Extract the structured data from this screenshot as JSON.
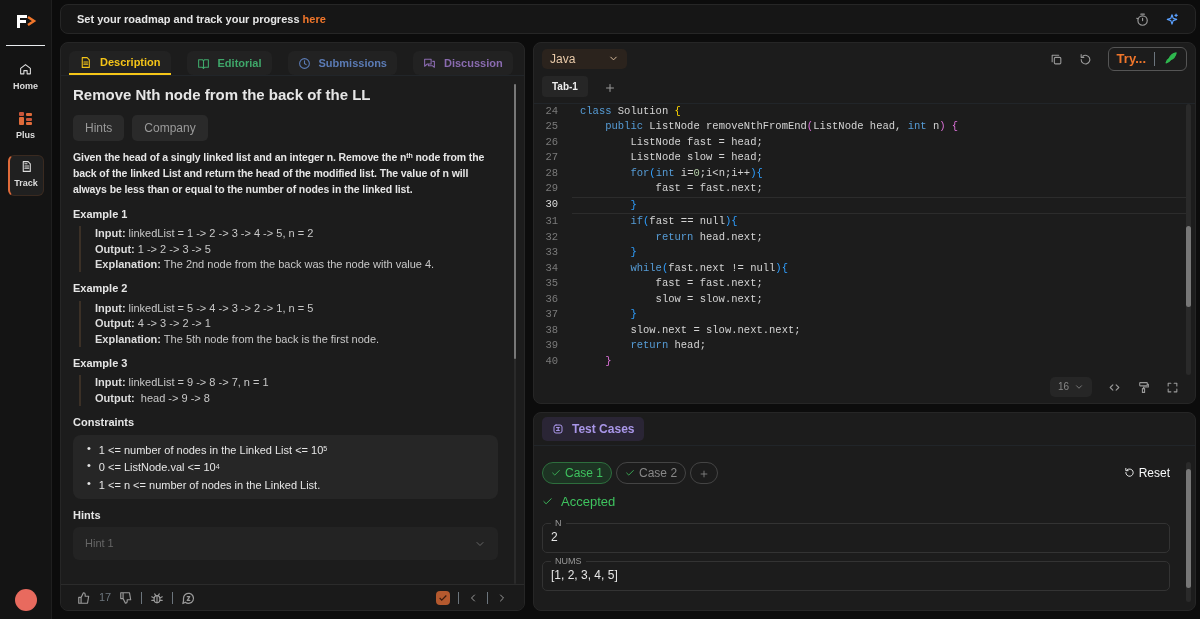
{
  "sidebar": {
    "items": [
      {
        "label": "Home",
        "kind": "home",
        "selected": false
      },
      {
        "label": "Plus",
        "kind": "plus",
        "selected": false
      },
      {
        "label": "Track",
        "kind": "track",
        "selected": true
      }
    ]
  },
  "banner": {
    "text": "Set your roadmap and track your progress",
    "link": "here"
  },
  "description": {
    "tabs": [
      {
        "label": "Description",
        "kind": "description",
        "selected": true,
        "color": "#f5c518"
      },
      {
        "label": "Editorial",
        "kind": "editorial",
        "selected": false,
        "color": "#3fa76a"
      },
      {
        "label": "Submissions",
        "kind": "submissions",
        "selected": false,
        "color": "#5b7bb5"
      },
      {
        "label": "Discussion",
        "kind": "discussion",
        "selected": false,
        "color": "#8a6bb0"
      }
    ],
    "title": "Remove Nth node from the back of the LL",
    "chips": [
      "Hints",
      "Company"
    ],
    "statement": "Given the head of a singly linked list and an integer n. Remove the n$^{th}$ node from the back of the linked List and return the head of the modified list. The value of n will always be less than or equal to the number of nodes in the linked list.",
    "examples": [
      {
        "title": "Example 1",
        "lines": [
          "**Input:** linkedList = 1 -> 2 -> 3 -> 4 -> 5, n = 2",
          "**Output:** 1 -> 2 -> 3 -> 5",
          "**Explanation:** The 2nd node from the back was the node with value 4."
        ]
      },
      {
        "title": "Example 2",
        "lines": [
          "**Input:** linkedList = 5 -> 4 -> 3 -> 2 -> 1, n = 5",
          "**Output:** 4 -> 3 -> 2 -> 1",
          "**Explanation:** The 5th node from the back is the first node."
        ]
      },
      {
        "title": "Example 3",
        "lines": [
          "**Input:** linkedList = 9 -> 8 -> 7, n = 1",
          "**Output:**  head -> 9 -> 8"
        ]
      }
    ],
    "constraints_title": "Constraints",
    "constraints": [
      {
        "bullet": "•",
        "text": "1 <= number of nodes in the Linked List <= 10$^{5}$"
      },
      {
        "bullet": "•",
        "text": "0 <= ListNode.val <= 10$^{4}$"
      },
      {
        "bullet": "•",
        "text": "1 <= n <= number of nodes in the Linked List."
      }
    ],
    "hints_title": "Hints",
    "hints": [
      {
        "label": "Hint 1",
        "expanded": false
      }
    ],
    "footer": {
      "likes": "17",
      "solved": true
    }
  },
  "editor": {
    "language": "Java",
    "run_button": "Try...",
    "tabs": [
      {
        "label": "Tab-1",
        "selected": true
      }
    ],
    "lines": [
      {
        "number": "24",
        "current": false,
        "segments": [
          {
            "kind": "kw",
            "text": "class"
          },
          {
            "kind": "plain",
            "text": " Solution "
          },
          {
            "kind": "b1",
            "text": "{"
          }
        ]
      },
      {
        "number": "25",
        "current": false,
        "segments": [
          {
            "kind": "kw",
            "text": "    public"
          },
          {
            "kind": "plain",
            "text": " ListNode removeNthFromEnd"
          },
          {
            "kind": "b2",
            "text": "("
          },
          {
            "kind": "plain",
            "text": "ListNode head, "
          },
          {
            "kind": "kw",
            "text": "int"
          },
          {
            "kind": "plain",
            "text": " n"
          },
          {
            "kind": "b2",
            "text": ") {"
          }
        ]
      },
      {
        "number": "26",
        "current": false,
        "segments": [
          {
            "kind": "plain",
            "text": "        ListNode fast = head;"
          }
        ]
      },
      {
        "number": "27",
        "current": false,
        "segments": [
          {
            "kind": "plain",
            "text": "        ListNode slow = head;"
          }
        ]
      },
      {
        "number": "28",
        "current": false,
        "segments": [
          {
            "kind": "kw",
            "text": "        for"
          },
          {
            "kind": "b3",
            "text": "("
          },
          {
            "kind": "kw",
            "text": "int"
          },
          {
            "kind": "plain",
            "text": " i="
          },
          {
            "kind": "num",
            "text": "0"
          },
          {
            "kind": "plain",
            "text": ";i<n;i++"
          },
          {
            "kind": "b3",
            "text": "){"
          }
        ]
      },
      {
        "number": "29",
        "current": false,
        "segments": [
          {
            "kind": "plain",
            "text": "            fast = fast.next;"
          }
        ]
      },
      {
        "number": "30",
        "current": true,
        "segments": [
          {
            "kind": "b3",
            "text": "        }"
          }
        ]
      },
      {
        "number": "31",
        "current": false,
        "segments": [
          {
            "kind": "kw",
            "text": "        if"
          },
          {
            "kind": "b3",
            "text": "("
          },
          {
            "kind": "plain",
            "text": "fast == null"
          },
          {
            "kind": "b3",
            "text": "){"
          }
        ]
      },
      {
        "number": "32",
        "current": false,
        "segments": [
          {
            "kind": "kw",
            "text": "            return"
          },
          {
            "kind": "plain",
            "text": " head.next;"
          }
        ]
      },
      {
        "number": "33",
        "current": false,
        "segments": [
          {
            "kind": "b3",
            "text": "        }"
          }
        ]
      },
      {
        "number": "34",
        "current": false,
        "segments": [
          {
            "kind": "kw",
            "text": "        while"
          },
          {
            "kind": "b3",
            "text": "("
          },
          {
            "kind": "plain",
            "text": "fast.next != null"
          },
          {
            "kind": "b3",
            "text": "){"
          }
        ]
      },
      {
        "number": "35",
        "current": false,
        "segments": [
          {
            "kind": "plain",
            "text": "            fast = fast.next;"
          }
        ]
      },
      {
        "number": "36",
        "current": false,
        "segments": [
          {
            "kind": "plain",
            "text": "            slow = slow.next;"
          }
        ]
      },
      {
        "number": "37",
        "current": false,
        "segments": [
          {
            "kind": "b3",
            "text": "        }"
          }
        ]
      },
      {
        "number": "38",
        "current": false,
        "segments": [
          {
            "kind": "plain",
            "text": "        slow.next = slow.next.next;"
          }
        ]
      },
      {
        "number": "39",
        "current": false,
        "segments": [
          {
            "kind": "kw",
            "text": "        return"
          },
          {
            "kind": "plain",
            "text": " head;"
          }
        ]
      },
      {
        "number": "40",
        "current": false,
        "segments": [
          {
            "kind": "b2",
            "text": "    }"
          }
        ]
      }
    ],
    "font_size": "16"
  },
  "testcases": {
    "tab": "Test Cases",
    "cases": [
      {
        "label": "Case 1",
        "selected": true,
        "passed": true
      },
      {
        "label": "Case 2",
        "selected": false,
        "passed": true
      }
    ],
    "reset": "Reset",
    "verdict": "Accepted",
    "fields": [
      {
        "label": "N",
        "value": "2"
      },
      {
        "label": "NUMS",
        "value": "[1, 2, 3, 4, 5]"
      }
    ]
  }
}
